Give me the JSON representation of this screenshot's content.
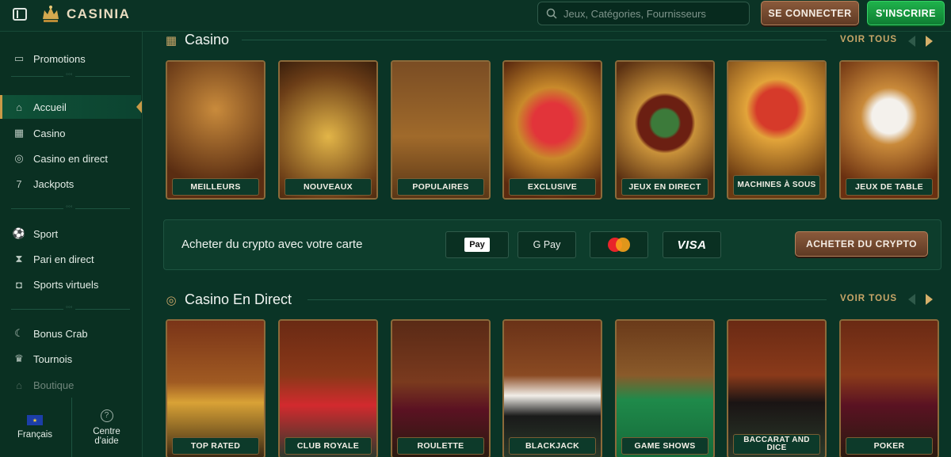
{
  "header": {
    "brand": "CASINIA",
    "search_placeholder": "Jeux, Catégories, Fournisseurs",
    "login_label": "SE CONNECTER",
    "signup_label": "S'INSCRIRE"
  },
  "sidebar": {
    "items": [
      {
        "label": "Promotions",
        "icon": "ticket-icon"
      },
      {
        "label": "Accueil",
        "icon": "home-icon",
        "active": true
      },
      {
        "label": "Casino",
        "icon": "casino-icon"
      },
      {
        "label": "Casino en direct",
        "icon": "chip-icon"
      },
      {
        "label": "Jackpots",
        "icon": "seven-icon"
      },
      {
        "label": "Sport",
        "icon": "soccer-ball-icon"
      },
      {
        "label": "Pari en direct",
        "icon": "live-bet-icon"
      },
      {
        "label": "Sports virtuels",
        "icon": "gamepad-icon"
      },
      {
        "label": "Bonus Crab",
        "icon": "crab-icon"
      },
      {
        "label": "Tournois",
        "icon": "trophy-icon"
      },
      {
        "label": "Boutique",
        "icon": "shop-icon"
      }
    ],
    "language": "Français",
    "help": "Centre d'aide"
  },
  "casino": {
    "title": "Casino",
    "see_all": "VOIR TOUS",
    "cards": [
      "MEILLEURS",
      "NOUVEAUX",
      "POPULAIRES",
      "EXCLUSIVE",
      "JEUX EN DIRECT",
      "MACHINES À SOUS",
      "JEUX DE TABLE"
    ]
  },
  "crypto": {
    "text": "Acheter du crypto avec votre carte",
    "apple_pay": "Pay",
    "google_pay": "G Pay",
    "visa": "VISA",
    "button": "ACHETER DU CRYPTO"
  },
  "live": {
    "title": "Casino En Direct",
    "see_all": "VOIR TOUS",
    "cards": [
      "TOP RATED",
      "CLUB ROYALE",
      "ROULETTE",
      "BLACKJACK",
      "GAME SHOWS",
      "BACCARAT AND DICE",
      "POKER"
    ]
  },
  "colors": {
    "background": "#0a3426",
    "accent_gold": "#c9a668",
    "signup_green": "#1fb24b",
    "login_brown": "#8a5a3b"
  }
}
